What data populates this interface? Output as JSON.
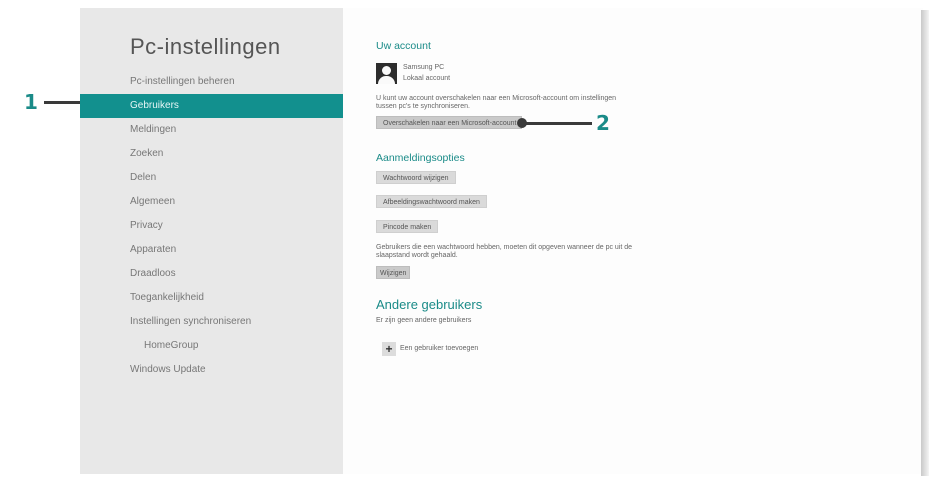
{
  "sidebar": {
    "title": "Pc-instellingen",
    "items": [
      {
        "label": "Pc-instellingen beheren"
      },
      {
        "label": "Gebruikers"
      },
      {
        "label": "Meldingen"
      },
      {
        "label": "Zoeken"
      },
      {
        "label": "Delen"
      },
      {
        "label": "Algemeen"
      },
      {
        "label": "Privacy"
      },
      {
        "label": "Apparaten"
      },
      {
        "label": "Draadloos"
      },
      {
        "label": "Toegankelijkheid"
      },
      {
        "label": "Instellingen synchroniseren"
      },
      {
        "label": "HomeGroup"
      },
      {
        "label": "Windows Update"
      }
    ]
  },
  "account": {
    "heading": "Uw account",
    "name": "Samsung PC",
    "type": "Lokaal account",
    "description": "U kunt uw account overschakelen naar een Microsoft-account om instellingen tussen pc's te synchroniseren.",
    "switch_button": "Overschakelen naar een Microsoft-account"
  },
  "signin": {
    "heading": "Aanmeldingsopties",
    "change_password": "Wachtwoord wijzigen",
    "picture_password": "Afbeeldingswachtwoord maken",
    "pin": "Pincode maken",
    "policy_text": "Gebruikers die een wachtwoord hebben, moeten dit opgeven wanneer de pc uit de slaapstand wordt gehaald.",
    "policy_button": "Wijzigen"
  },
  "other_users": {
    "heading": "Andere gebruikers",
    "text": "Er zijn geen andere gebruikers",
    "add_label": "Een gebruiker toevoegen",
    "add_icon": "+"
  },
  "callouts": {
    "one": "1",
    "two": "2"
  },
  "colors": {
    "accent": "#12908e",
    "sidebar": "#e8e8e8",
    "callout": "#1a8b88"
  }
}
